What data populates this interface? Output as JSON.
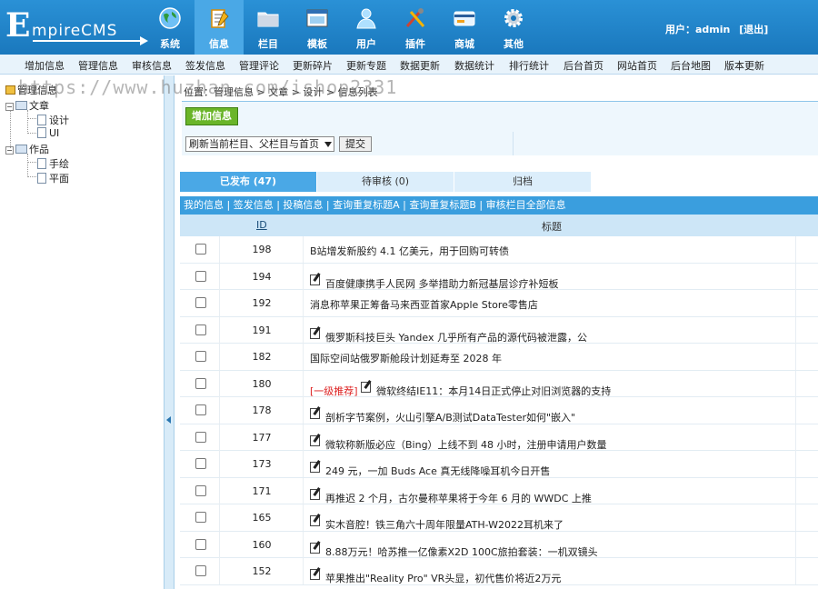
{
  "logo": {
    "first": "E",
    "rest": "mpireCMS"
  },
  "nav": [
    {
      "label": "系统",
      "icon": "globe-icon"
    },
    {
      "label": "信息",
      "icon": "notepad-icon"
    },
    {
      "label": "栏目",
      "icon": "folder-icon"
    },
    {
      "label": "模板",
      "icon": "window-icon"
    },
    {
      "label": "用户",
      "icon": "user-icon"
    },
    {
      "label": "插件",
      "icon": "tools-icon"
    },
    {
      "label": "商城",
      "icon": "card-icon"
    },
    {
      "label": "其他",
      "icon": "gear-icon"
    }
  ],
  "user": {
    "label": "用户：admin",
    "logout": "[退出]"
  },
  "subnav": [
    "增加信息",
    "管理信息",
    "审核信息",
    "签发信息",
    "管理评论",
    "更新碎片",
    "更新专题",
    "数据更新",
    "数据统计",
    "排行统计",
    "后台首页",
    "网站首页",
    "后台地图",
    "版本更新"
  ],
  "tree": {
    "root": "管理信息",
    "nodes": [
      {
        "label": "文章",
        "children": [
          "设计",
          "UI"
        ]
      },
      {
        "label": "作品",
        "children": [
          "手绘",
          "平面"
        ]
      }
    ]
  },
  "watermark": "https://www.huzhan.com/ishop2331",
  "breadcrumb": "位置：管理信息 > 文章 > 设计 > 信息列表",
  "toolbar": {
    "add_label": "增加信息",
    "refresh_option": "刷新当前栏目、父栏目与首页",
    "submit_label": "提交"
  },
  "tabs": [
    "已发布 (47)",
    "待审核 (0)",
    "归档"
  ],
  "links": "我的信息 | 签发信息 | 投稿信息 | 查询重复标题A | 查询重复标题B | 审核栏目全部信息",
  "table": {
    "headers": {
      "id": "ID",
      "title": "标题"
    },
    "rows": [
      {
        "id": "198",
        "title": "B站增发新股约 4.1 亿美元，用于回购可转债",
        "icon": false,
        "tag": ""
      },
      {
        "id": "194",
        "title": "百度健康携手人民网 多举措助力新冠基层诊疗补短板",
        "icon": true,
        "tag": ""
      },
      {
        "id": "192",
        "title": "消息称苹果正筹备马来西亚首家Apple Store零售店",
        "icon": false,
        "tag": ""
      },
      {
        "id": "191",
        "title": "俄罗斯科技巨头 Yandex 几乎所有产品的源代码被泄露，公",
        "icon": true,
        "tag": ""
      },
      {
        "id": "182",
        "title": "国际空间站俄罗斯舱段计划延寿至 2028 年",
        "icon": false,
        "tag": ""
      },
      {
        "id": "180",
        "title": "微软终结IE11：本月14日正式停止对旧浏览器的支持",
        "icon": true,
        "tag": "[一级推荐]"
      },
      {
        "id": "178",
        "title": "剖析字节案例，火山引擎A/B测试DataTester如何\"嵌入\"",
        "icon": true,
        "tag": ""
      },
      {
        "id": "177",
        "title": "微软称新版必应（Bing）上线不到 48 小时，注册申请用户数量",
        "icon": true,
        "tag": ""
      },
      {
        "id": "173",
        "title": "249 元，一加 Buds Ace 真无线降噪耳机今日开售",
        "icon": true,
        "tag": ""
      },
      {
        "id": "171",
        "title": "再推迟 2 个月，古尔曼称苹果将于今年 6 月的 WWDC 上推",
        "icon": true,
        "tag": ""
      },
      {
        "id": "165",
        "title": "实木音腔！铁三角六十周年限量ATH-W2022耳机来了",
        "icon": true,
        "tag": ""
      },
      {
        "id": "160",
        "title": "8.88万元！哈苏推一亿像素X2D 100C旅拍套装：一机双镜头",
        "icon": true,
        "tag": ""
      },
      {
        "id": "152",
        "title": "苹果推出\"Reality Pro\" VR头显，初代售价将近2万元",
        "icon": true,
        "tag": ""
      }
    ]
  },
  "colors": {
    "topbar": "#1f84c9",
    "active_tab": "#4aa8e6",
    "add_button": "#6ab529",
    "recommend_tag": "#dd2222"
  }
}
